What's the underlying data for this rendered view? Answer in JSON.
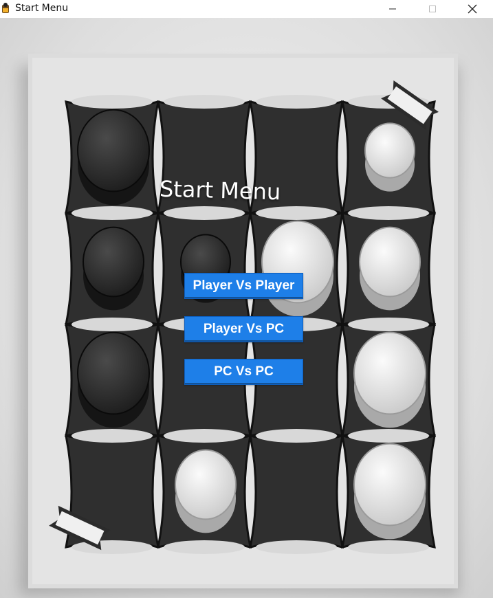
{
  "window": {
    "title": "Start Menu"
  },
  "menu": {
    "heading": "Start Menu",
    "buttons": {
      "player_vs_player": "Player Vs Player",
      "player_vs_pc": "Player Vs PC",
      "pc_vs_pc": "PC Vs PC"
    }
  },
  "colors": {
    "button": "#1e7fe8",
    "board_dark": "#2f2f2f",
    "board_light": "#e6e6e6"
  },
  "board": {
    "rows": 4,
    "cols": 4,
    "pieces": [
      {
        "row": 0,
        "col": 0,
        "color": "dark",
        "size": "large"
      },
      {
        "row": 0,
        "col": 3,
        "color": "light",
        "size": "small"
      },
      {
        "row": 1,
        "col": 0,
        "color": "dark",
        "size": "medium"
      },
      {
        "row": 1,
        "col": 1,
        "color": "dark",
        "size": "small"
      },
      {
        "row": 1,
        "col": 2,
        "color": "light",
        "size": "large"
      },
      {
        "row": 1,
        "col": 3,
        "color": "light",
        "size": "medium"
      },
      {
        "row": 2,
        "col": 0,
        "color": "dark",
        "size": "large"
      },
      {
        "row": 2,
        "col": 3,
        "color": "light",
        "size": "large"
      },
      {
        "row": 3,
        "col": 1,
        "color": "light",
        "size": "medium"
      },
      {
        "row": 3,
        "col": 3,
        "color": "light",
        "size": "large"
      }
    ]
  }
}
